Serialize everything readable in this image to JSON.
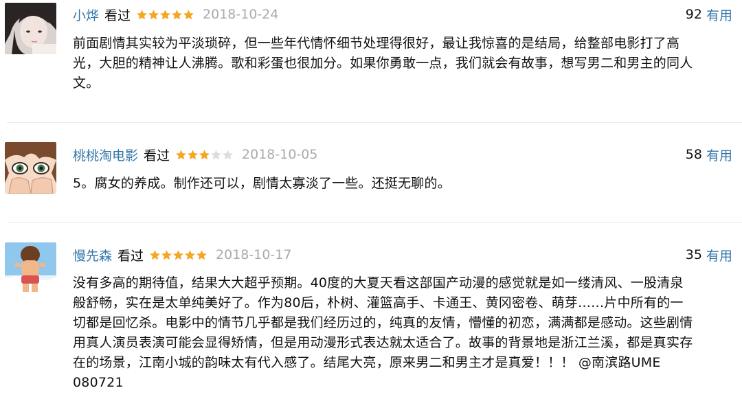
{
  "colors": {
    "username": "#3377aa",
    "star_filled": "#f5a623",
    "star_empty": "#dddddd",
    "date": "#aaaaaa",
    "useful_label": "#3377aa"
  },
  "reviews": [
    {
      "user": "小烨",
      "watched": "看过",
      "rating": 5,
      "date": "2018-10-24",
      "useful_count": "92",
      "useful_label": "有用",
      "avatar_icon": "girl-portrait-avatar",
      "text": "前面剧情其实较为平淡琐碎，但一些年代情怀细节处理得很好，最让我惊喜的是结局，给整部电影打了高\n光，大胆的精神让人沸腾。歌和彩蛋也很加分。如果你勇敢一点，我们就会有故事，想写男二和男主的同人\n文。"
    },
    {
      "user": "桃桃淘电影",
      "watched": "看过",
      "rating": 3,
      "date": "2018-10-05",
      "useful_count": "58",
      "useful_label": "有用",
      "avatar_icon": "anime-face-avatar",
      "text": "5。腐女的养成。制作还可以，剧情太寡淡了一些。还挺无聊的。"
    },
    {
      "user": "慢先森",
      "watched": "看过",
      "rating": 5,
      "date": "2018-10-17",
      "useful_count": "35",
      "useful_label": "有用",
      "avatar_icon": "cartoon-boy-avatar",
      "text": "没有多高的期待值，结果大大超乎预期。40度的大夏天看这部国产动漫的感觉就是如一缕清风、一股清泉\n般舒畅，实在是太单纯美好了。作为80后，朴树、灌篮高手、卡通王、黄冈密卷、萌芽……片中所有的一\n切都是回忆杀。电影中的情节几乎都是我们经历过的，纯真的友情，懵懂的初恋，满满都是感动。这些剧情\n用真人演员表演可能会显得矫情，但是用动漫形式表达就太适合了。故事的背景地是浙江兰溪，都是真实存\n在的场景，江南小城的韵味太有代入感了。结尾大亮，原来男二和男主才是真爱！！！ @南滨路UME\n080721"
    }
  ]
}
